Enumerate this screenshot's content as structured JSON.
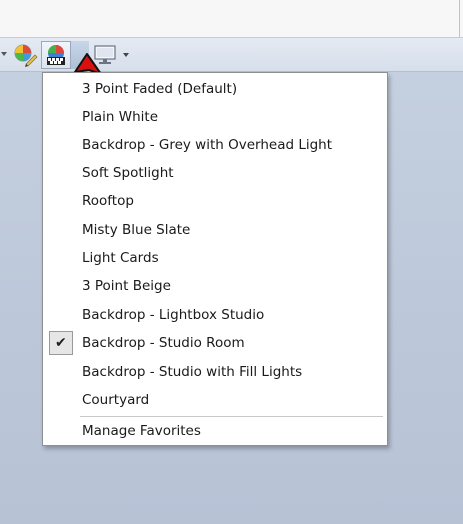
{
  "toolbar": {
    "icons": [
      {
        "name": "material-edit-icon"
      },
      {
        "name": "lighting-presets-icon"
      },
      {
        "name": "display-icon"
      }
    ]
  },
  "menu": {
    "items": [
      {
        "label": "3 Point Faded  (Default)",
        "checked": false
      },
      {
        "label": "Plain White",
        "checked": false
      },
      {
        "label": "Backdrop - Grey with Overhead Light",
        "checked": false
      },
      {
        "label": "Soft Spotlight",
        "checked": false
      },
      {
        "label": "Rooftop",
        "checked": false
      },
      {
        "label": "Misty Blue Slate",
        "checked": false
      },
      {
        "label": "Light Cards",
        "checked": false
      },
      {
        "label": "3 Point Beige",
        "checked": false
      },
      {
        "label": "Backdrop - Lightbox Studio",
        "checked": false
      },
      {
        "label": "Backdrop - Studio Room",
        "checked": true
      },
      {
        "label": "Backdrop - Studio with Fill Lights",
        "checked": false
      },
      {
        "label": "Courtyard",
        "checked": false
      }
    ],
    "footer": {
      "label": "Manage Favorites"
    },
    "check_glyph": "✔"
  }
}
